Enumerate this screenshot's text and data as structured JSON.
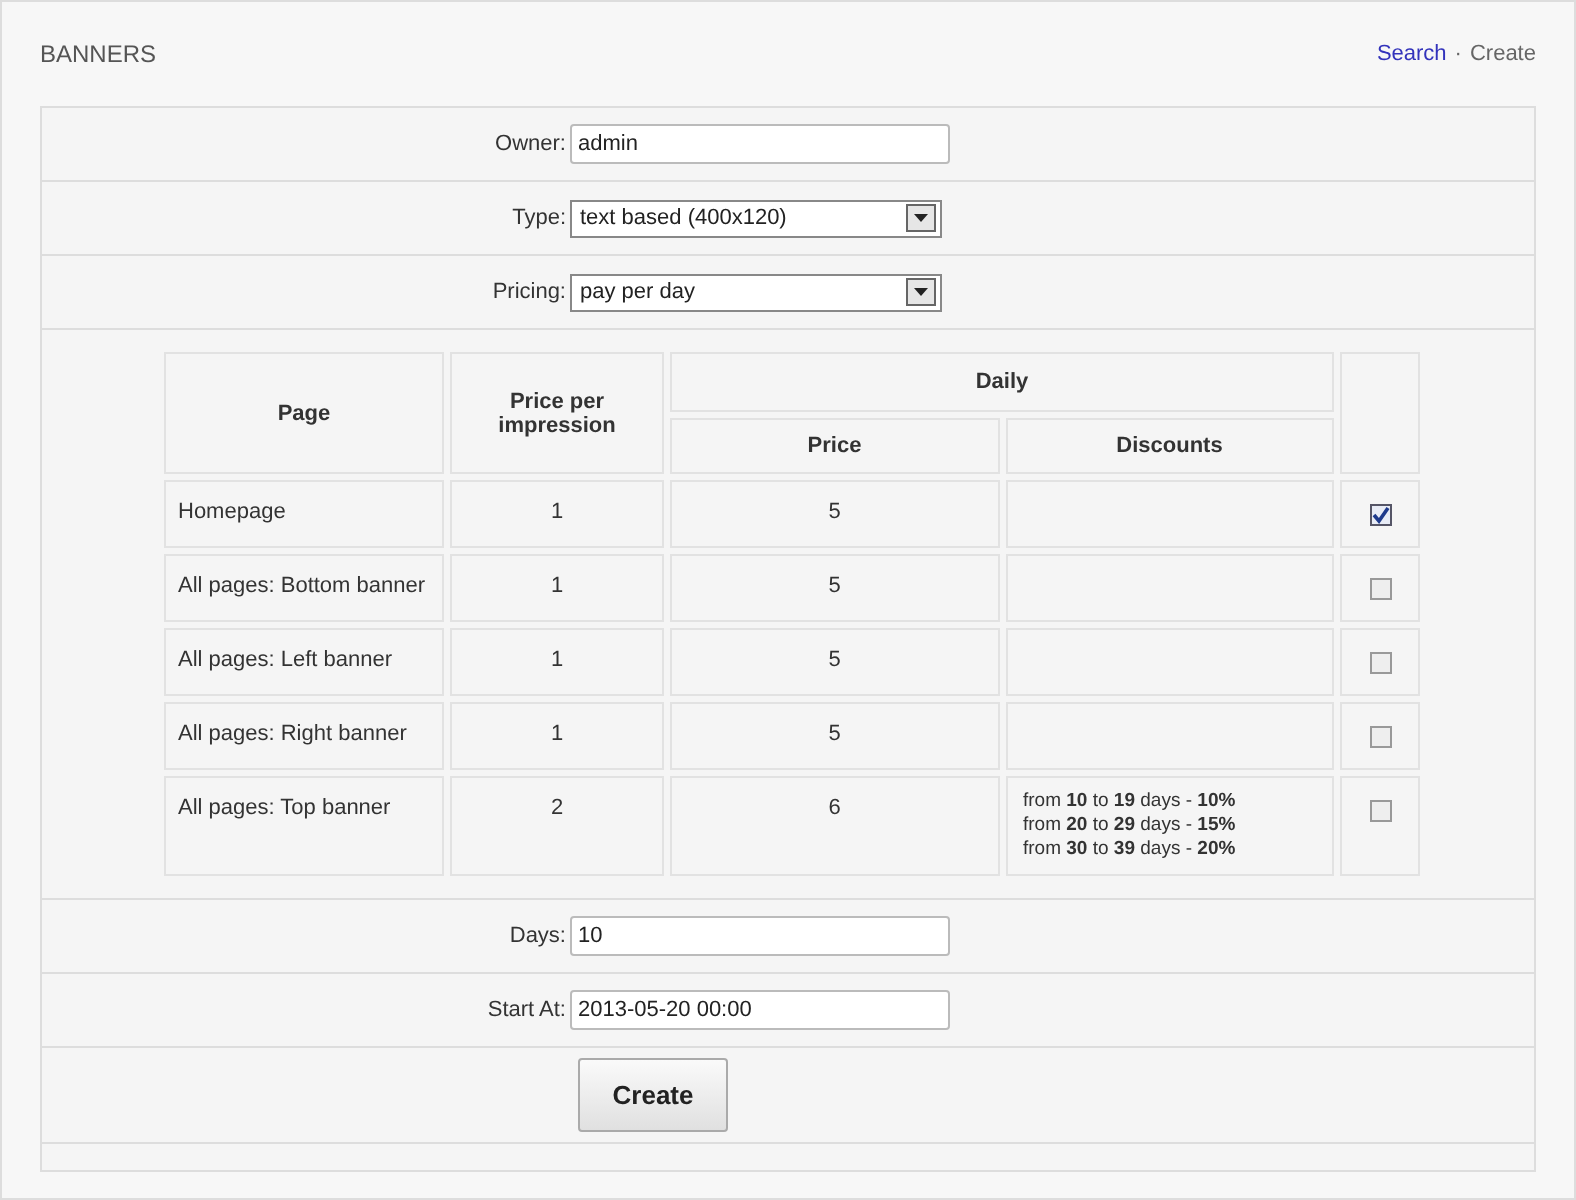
{
  "header": {
    "title": "BANNERS",
    "links": [
      {
        "label": "Search",
        "kind": "link"
      },
      {
        "label": "·",
        "kind": "separator"
      },
      {
        "label": "Create",
        "kind": "current"
      }
    ]
  },
  "fields": [
    {
      "label": "Owner:",
      "kind": "text",
      "value": "admin"
    },
    {
      "label": "Type:",
      "kind": "select",
      "value": "text based (400x120)"
    },
    {
      "label": "Pricing:",
      "kind": "select",
      "value": "pay per day"
    }
  ],
  "table": {
    "columns": {
      "page": "Page",
      "impression": "Price per impression",
      "daily": "Daily",
      "price": "Price",
      "discounts": "Discounts"
    },
    "rows": [
      {
        "page": "Homepage",
        "impression": "1",
        "price": "5",
        "discounts": [],
        "checked": true
      },
      {
        "page": "All pages: Bottom banner",
        "impression": "1",
        "price": "5",
        "discounts": [],
        "checked": false
      },
      {
        "page": "All pages: Left banner",
        "impression": "1",
        "price": "5",
        "discounts": [],
        "checked": false
      },
      {
        "page": "All pages: Right banner",
        "impression": "1",
        "price": "5",
        "discounts": [],
        "checked": false
      },
      {
        "page": "All pages: Top banner",
        "impression": "2",
        "price": "6",
        "discounts": [
          "from **10** to **19** days - **10%**",
          "from **20** to **29** days - **15%**",
          "from **30** to **39** days - **20%**"
        ],
        "checked": false
      }
    ]
  },
  "fields_after": [
    {
      "label": "Days:",
      "kind": "text",
      "value": "10"
    },
    {
      "label": "Start At:",
      "kind": "text",
      "value": "2013-05-20 00:00"
    }
  ],
  "submit": {
    "label": "Create"
  }
}
